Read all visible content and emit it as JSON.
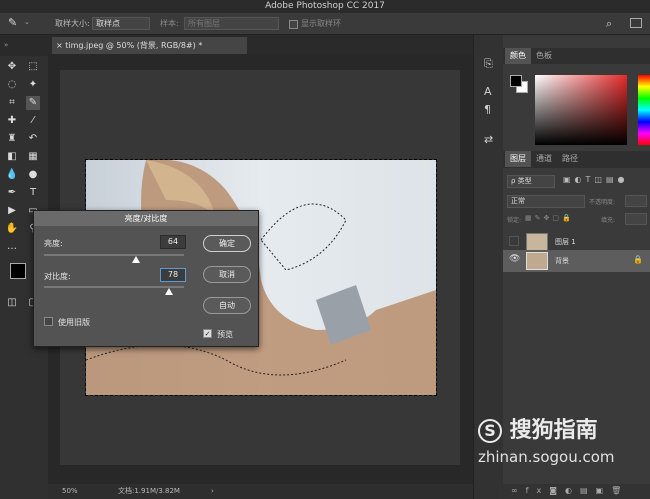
{
  "app": {
    "title": "Adobe Photoshop CC 2017"
  },
  "options_bar": {
    "sample_size_label": "取样大小:",
    "sample_size_value": "取样点",
    "sample_label": "样本:",
    "sample_value": "所有图层",
    "show_ring_label": "显示取样环"
  },
  "document": {
    "tab_label": "timg.jpeg @ 50% (背景, RGB/8#) *",
    "zoom": "50%",
    "doc_info": "文档:1.91M/3.82M"
  },
  "dialog": {
    "title": "亮度/对比度",
    "brightness_label": "亮度:",
    "brightness_value": "64",
    "brightness_fraction": 0.66,
    "contrast_label": "对比度:",
    "contrast_value": "78",
    "contrast_fraction": 0.89,
    "ok_label": "确定",
    "cancel_label": "取消",
    "auto_label": "自动",
    "legacy_label": "使用旧版",
    "legacy_checked": false,
    "preview_label": "预览",
    "preview_checked": true
  },
  "color_panel": {
    "tab_color": "颜色",
    "tab_swatches": "色板"
  },
  "layers_panel": {
    "tabs": [
      "图层",
      "通道",
      "路径"
    ],
    "filter_label": "ρ 类型",
    "blend_mode": "正常",
    "opacity_label": "不透明度:",
    "lock_label": "锁定:",
    "fill_label": "填充:",
    "layers": [
      {
        "name": "图层 1",
        "visible": false
      },
      {
        "name": "背景",
        "visible": true,
        "locked": true
      }
    ]
  },
  "watermark": {
    "brand": "搜狗指南",
    "url": "zhinan.sogou.com"
  }
}
